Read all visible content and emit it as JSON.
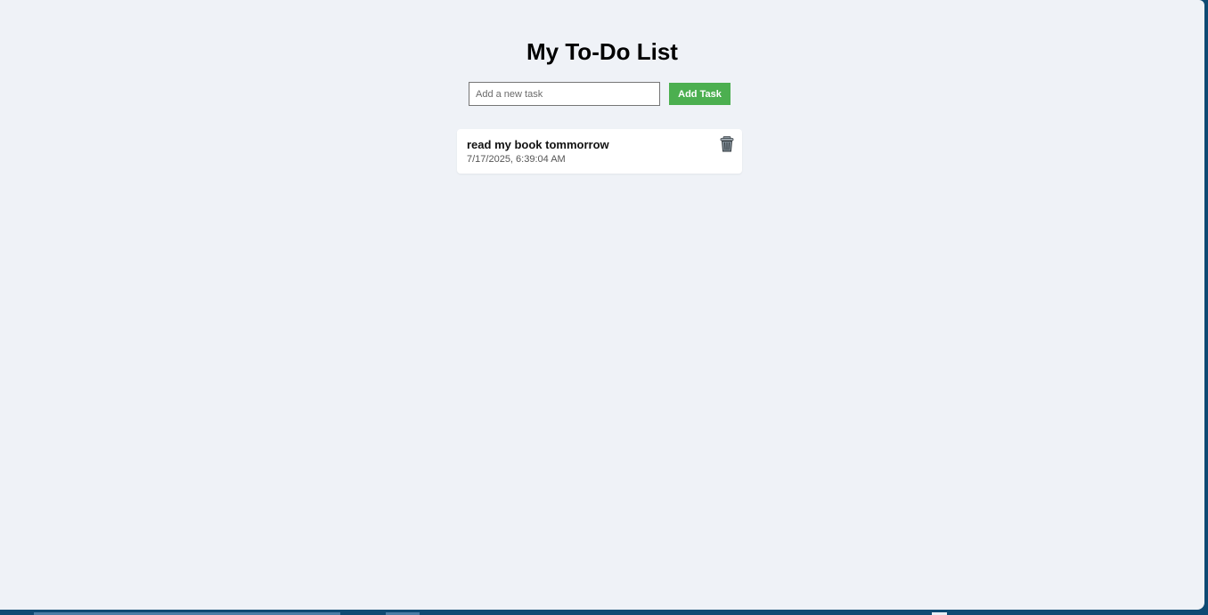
{
  "app": {
    "title": "My To-Do List"
  },
  "add_form": {
    "input_placeholder": "Add a new task",
    "input_value": "",
    "button_label": "Add Task"
  },
  "tasks": [
    {
      "text": "read my book tommorrow",
      "timestamp": "7/17/2025, 6:39:04 AM",
      "delete_icon": "trash-icon"
    }
  ],
  "colors": {
    "background": "#eff2f7",
    "add_button": "#4caf50",
    "card": "#ffffff",
    "taskbar": "#0e4a73"
  }
}
